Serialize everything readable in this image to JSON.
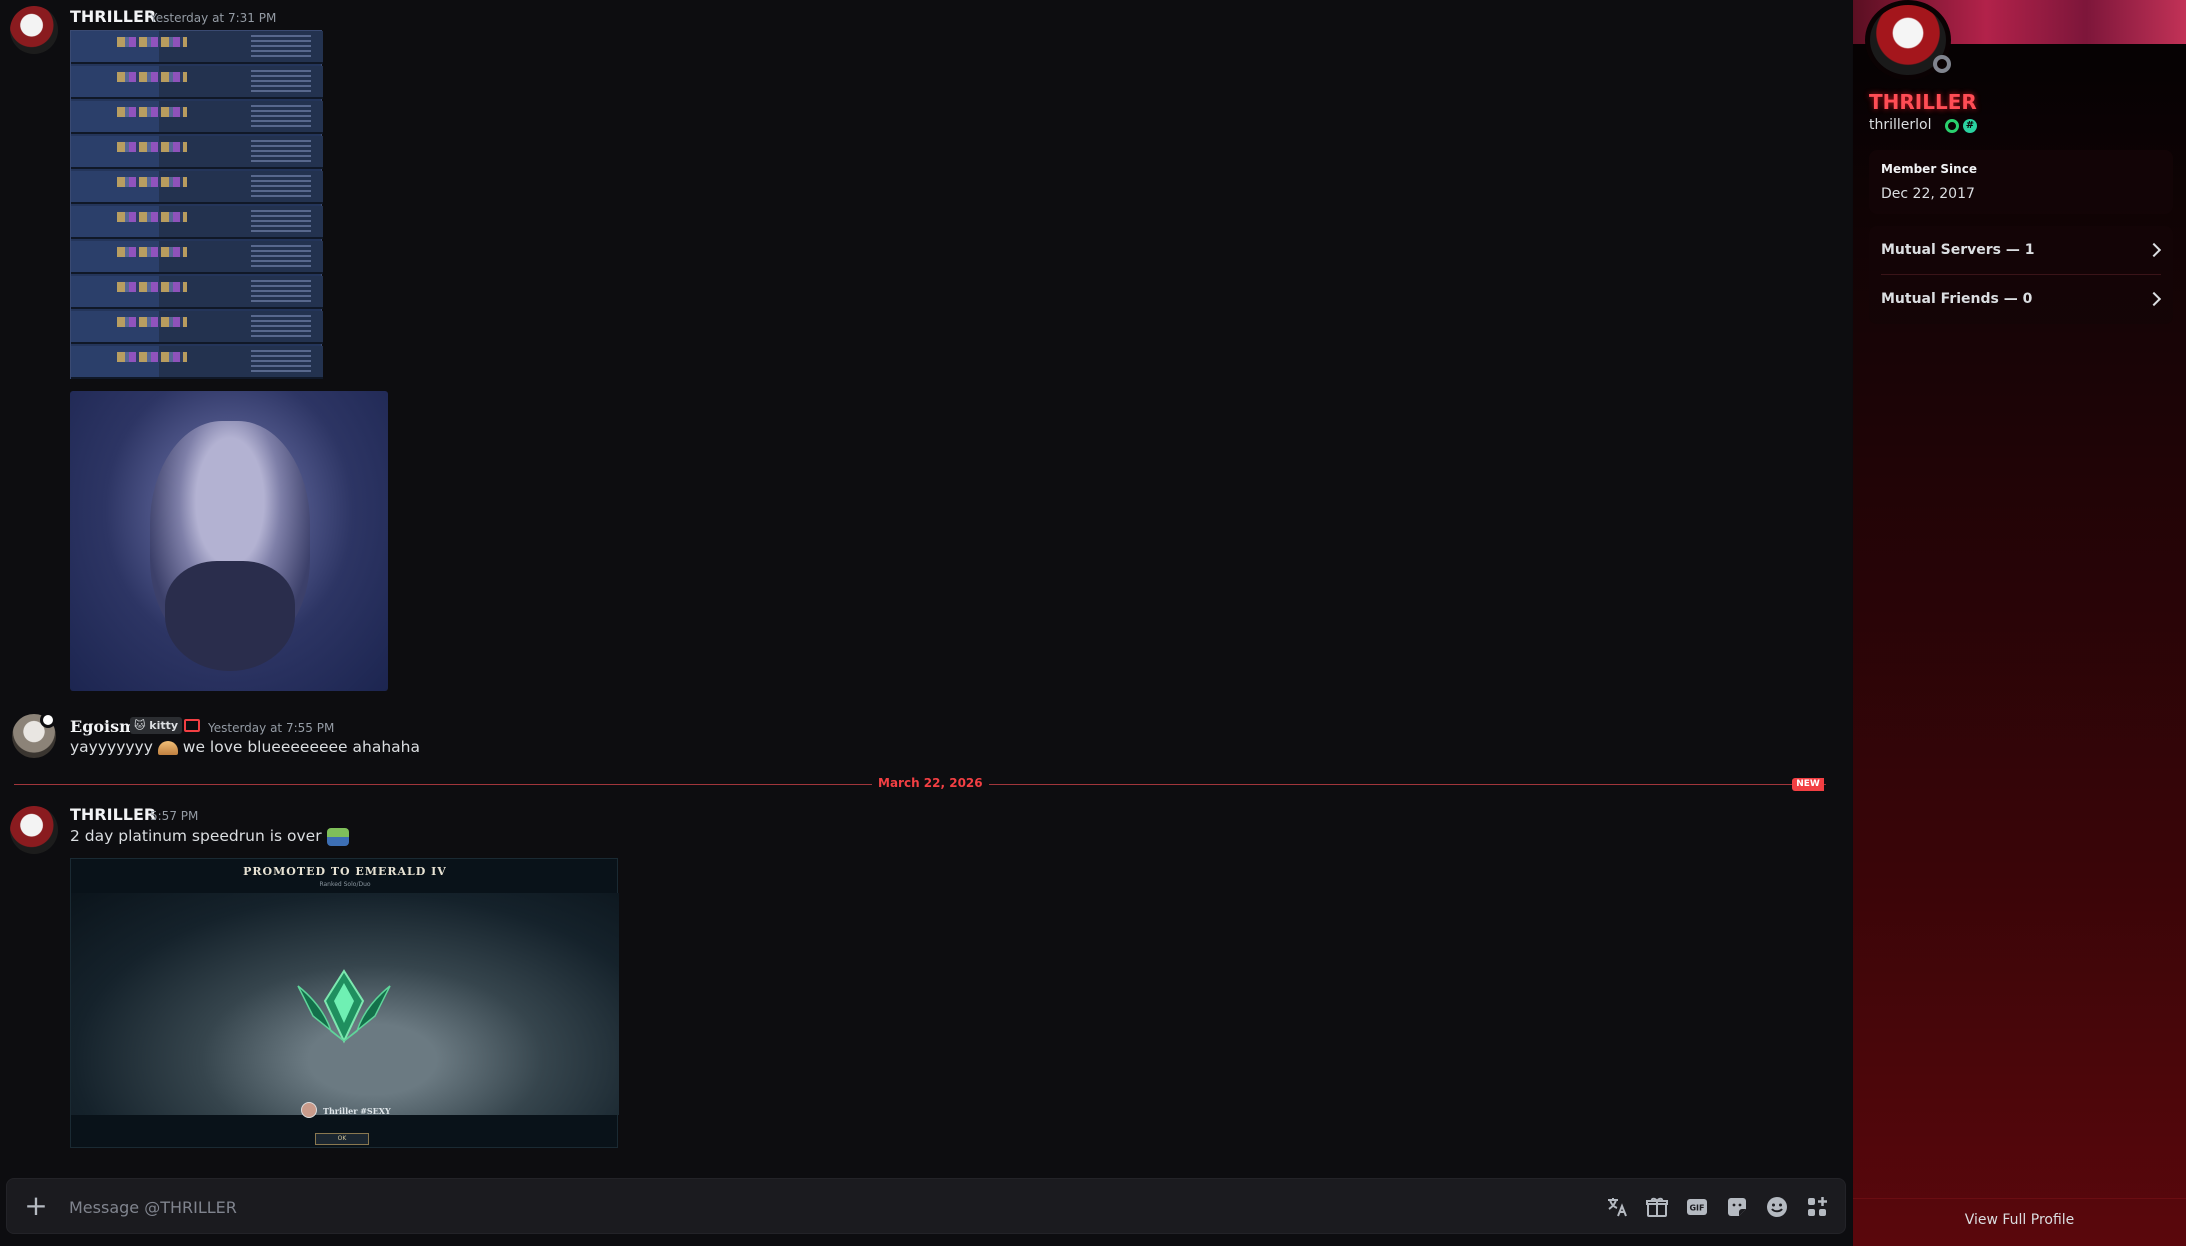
{
  "messages": [
    {
      "author": "THRILLER",
      "time": "Yesterday at 7:31 PM"
    },
    {
      "author": "Egoism",
      "tag": "🐱 kitty",
      "time": "Yesterday at 7:55 PM",
      "text_a": "yayyyyyyy",
      "text_b": "we love blueeeeeeee ahahaha"
    },
    {
      "author": "THRILLER",
      "time": "5:57 PM",
      "text": "2 day platinum speedrun is over"
    }
  ],
  "divider": {
    "date": "March 22, 2026",
    "badge": "NEW"
  },
  "rank_card": {
    "title": "PROMOTED TO EMERALD IV",
    "subtitle": "Ranked Solo/Duo",
    "player": "Thriller #SEXY",
    "button": "OK"
  },
  "composer": {
    "placeholder": "Message @THRILLER"
  },
  "profile": {
    "display_name": "THRILLER",
    "username": "thrillerlol",
    "member_since_label": "Member Since",
    "member_since_value": "Dec 22, 2017",
    "mutual_servers": "Mutual Servers — 1",
    "mutual_friends": "Mutual Friends — 0",
    "view_full": "View Full Profile"
  },
  "icons": {
    "translate": "translate-icon",
    "gift": "gift-icon",
    "gif": "gif-icon",
    "sticker": "sticker-icon",
    "emoji": "emoji-icon",
    "apps": "apps-icon"
  },
  "colors": {
    "accent_red": "#f23f43",
    "name_red": "#ff4d55",
    "panel_bottom": "#5a070c"
  }
}
